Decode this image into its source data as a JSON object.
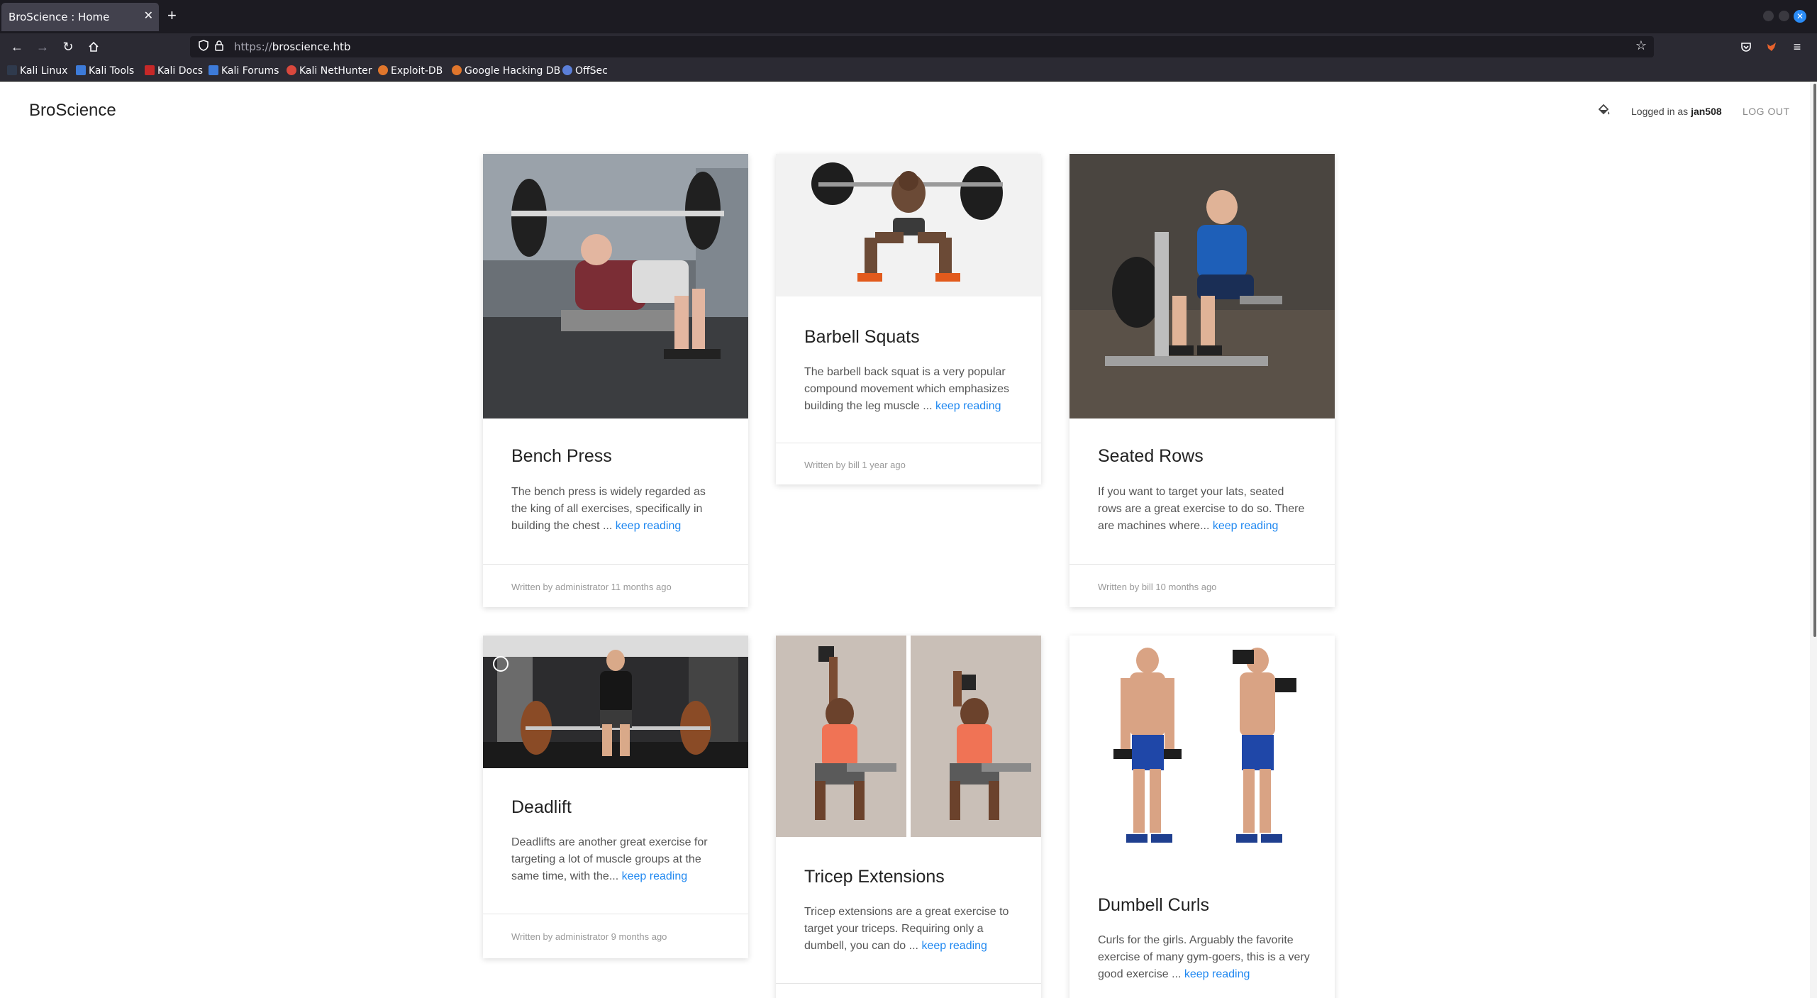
{
  "browser": {
    "tab_title": "BroScience : Home",
    "tab_close": "✕",
    "new_tab": "+",
    "url_scheme": "https://",
    "url_host": "broscience.htb",
    "bookmarks": [
      {
        "label": "Kali Linux",
        "color": "#3d7bd9"
      },
      {
        "label": "Kali Tools",
        "color": "#d9483d"
      },
      {
        "label": "Kali Docs",
        "color": "#c62828"
      },
      {
        "label": "Kali Forums",
        "color": "#3d7bd9"
      },
      {
        "label": "Kali NetHunter",
        "color": "#d9483d"
      },
      {
        "label": "Exploit-DB",
        "color": "#e0762c"
      },
      {
        "label": "Google Hacking DB",
        "color": "#e0762c"
      },
      {
        "label": "OffSec",
        "color": "#5b7fd9"
      }
    ]
  },
  "site": {
    "title": "BroScience",
    "logged_in_prefix": "Logged in as ",
    "username": "jan508",
    "logout": "LOG OUT",
    "accent": "#1e87f0"
  },
  "posts": [
    {
      "title": "Bench Press",
      "excerpt": "The bench press is widely regarded as the king of all exercises, specifically in building the chest ...",
      "link": "keep reading",
      "meta": "Written by administrator 11 months ago"
    },
    {
      "title": "Barbell Squats",
      "excerpt": "The barbell back squat is a very popular compound movement which emphasizes building the leg muscle ...",
      "link": "keep reading",
      "meta": "Written by bill 1 year ago"
    },
    {
      "title": "Seated Rows",
      "excerpt": "If you want to target your lats, seated rows are a great exercise to do so. There are machines where...",
      "link": "keep reading",
      "meta": "Written by bill 10 months ago"
    },
    {
      "title": "Deadlift",
      "excerpt": "Deadlifts are another great exercise for targeting a lot of muscle groups at the same time, with the...",
      "link": "keep reading",
      "meta": "Written by administrator 9 months ago"
    },
    {
      "title": "Tricep Extensions",
      "excerpt": "Tricep extensions are a great exercise to target your triceps. Requiring only a dumbell, you can do ...",
      "link": "keep reading",
      "meta": ""
    },
    {
      "title": "Dumbell Curls",
      "excerpt": "Curls for the girls. Arguably the favorite exercise of many gym-goers, this is a very good exercise ...",
      "link": "keep reading",
      "meta": ""
    }
  ]
}
